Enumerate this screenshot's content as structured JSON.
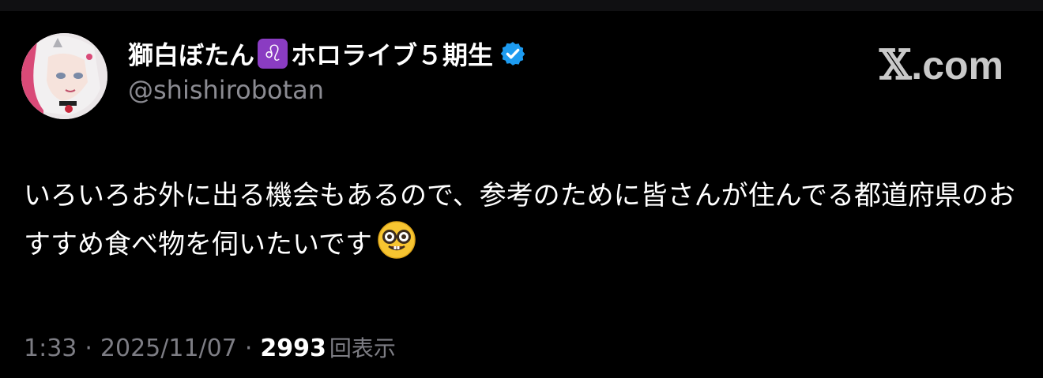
{
  "author": {
    "display_name": "獅白ぼたん",
    "zodiac_icon": "leo-icon",
    "zodiac_glyph": "♌",
    "name_suffix": "ホロライブ５期生",
    "verified_icon": "verified-badge-icon",
    "handle": "@shishirobotan"
  },
  "brand": {
    "x_glyph": "𝕏",
    "domain": ".com"
  },
  "tweet": {
    "text": "いろいろお外に出る機会もあるので、参考のために皆さんが住んでる都道府県のおすすめ食べ物を伺いたいです",
    "emoji_icon": "nerd-face-emoji"
  },
  "meta": {
    "time": "1:33",
    "separator": "·",
    "date": "2025/11/07",
    "views_count": "2993",
    "views_label": "回表示"
  },
  "colors": {
    "background": "#000000",
    "text": "#ffffff",
    "muted": "#8b8b92",
    "verified_blue": "#1d9bf0",
    "leo_purple": "#8a3cc2"
  }
}
